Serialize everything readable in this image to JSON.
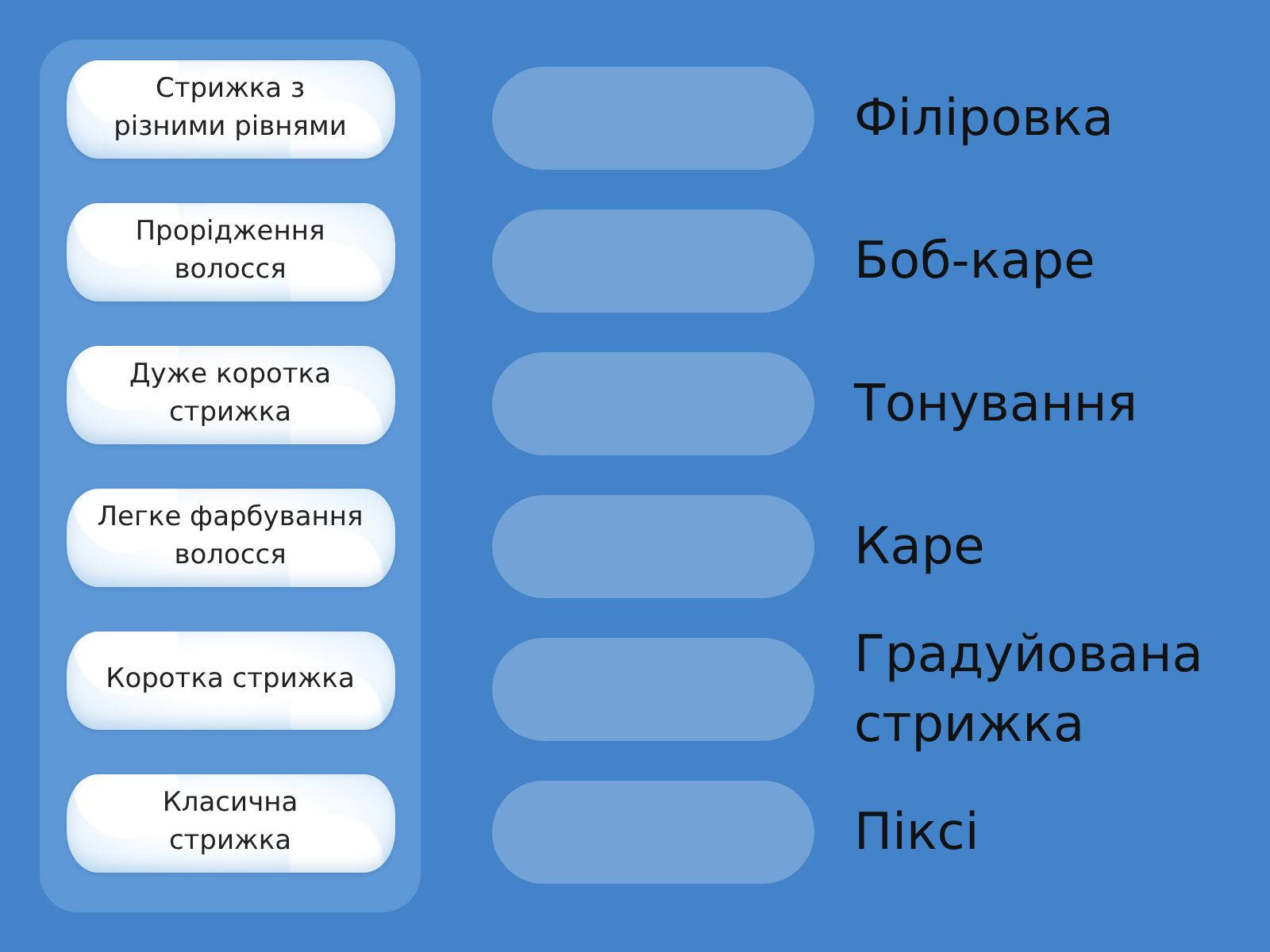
{
  "cards": [
    {
      "text": "Стрижка з\nрізними рівнями"
    },
    {
      "text": "Прорідження\nволосся"
    },
    {
      "text": "Дуже коротка\nстрижка"
    },
    {
      "text": "Легке фарбування\nволосся"
    },
    {
      "text": "Коротка стрижка"
    },
    {
      "text": "Класична\nстрижка"
    }
  ],
  "targets": [
    {
      "label": "Філіровка"
    },
    {
      "label": "Боб-каре"
    },
    {
      "label": "Тонування"
    },
    {
      "label": "Каре"
    },
    {
      "label": "Градуйована стрижка"
    },
    {
      "label": "Піксі"
    }
  ]
}
